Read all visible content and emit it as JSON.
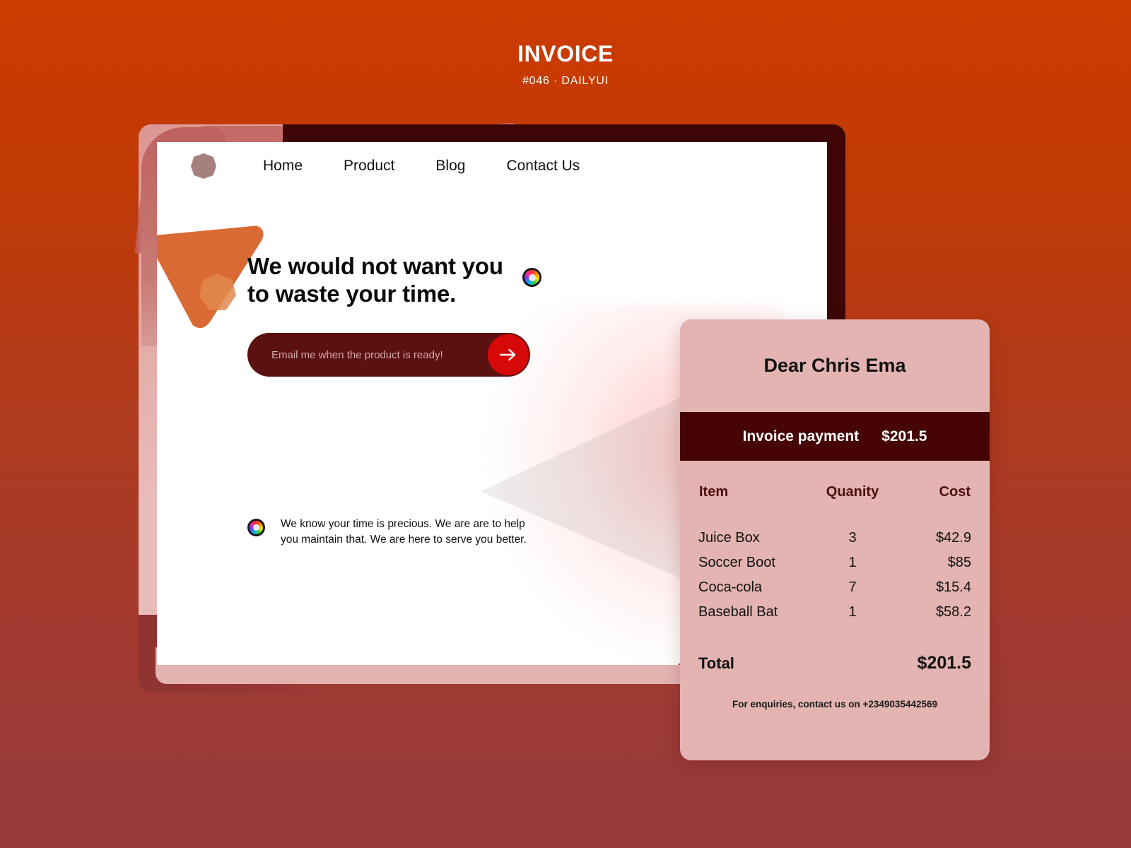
{
  "header": {
    "title": "INVOICE",
    "subtitle": "#046  ·  DAILYUI"
  },
  "browser": {
    "logo_icon": "octagon-logo-icon",
    "nav": [
      {
        "label": "Home"
      },
      {
        "label": "Product"
      },
      {
        "label": "Blog"
      },
      {
        "label": "Contact Us"
      }
    ],
    "hero": {
      "line1": "We would not want you",
      "line2": "to waste your time.",
      "accent_icon": "rainbow-ring-icon"
    },
    "subscribe": {
      "placeholder": "Email me when the product is ready!",
      "value": "",
      "submit_icon": "arrow-right-icon"
    },
    "note": {
      "icon": "rainbow-ring-icon",
      "text": "We know your time is precious.  We are are to help you maintain that. We are here to serve you better."
    }
  },
  "invoice": {
    "greeting": "Dear Chris Ema",
    "payment_label": "Invoice payment",
    "payment_amount": "$201.5",
    "columns": {
      "item": "Item",
      "quantity": "Quanity",
      "cost": "Cost"
    },
    "rows": [
      {
        "item": "Juice Box",
        "quantity": "3",
        "cost": "$42.9"
      },
      {
        "item": "Soccer Boot",
        "quantity": "1",
        "cost": "$85"
      },
      {
        "item": "Coca-cola",
        "quantity": "7",
        "cost": "$15.4"
      },
      {
        "item": "Baseball Bat",
        "quantity": "1",
        "cost": "$58.2"
      }
    ],
    "total_label": "Total",
    "total_value": "$201.5",
    "footer": "For enquiries, contact us on +2349035442569"
  },
  "colors": {
    "background_top": "#cc3b00",
    "background_bottom": "#96393b",
    "card_pink": "#e3b4b2",
    "band_dark": "#460404",
    "accent_red": "#d60808",
    "bright_red_shape": "#fa2f2f",
    "orange_shape": "#d96a33",
    "frame_pink": "#e8b9b6"
  }
}
